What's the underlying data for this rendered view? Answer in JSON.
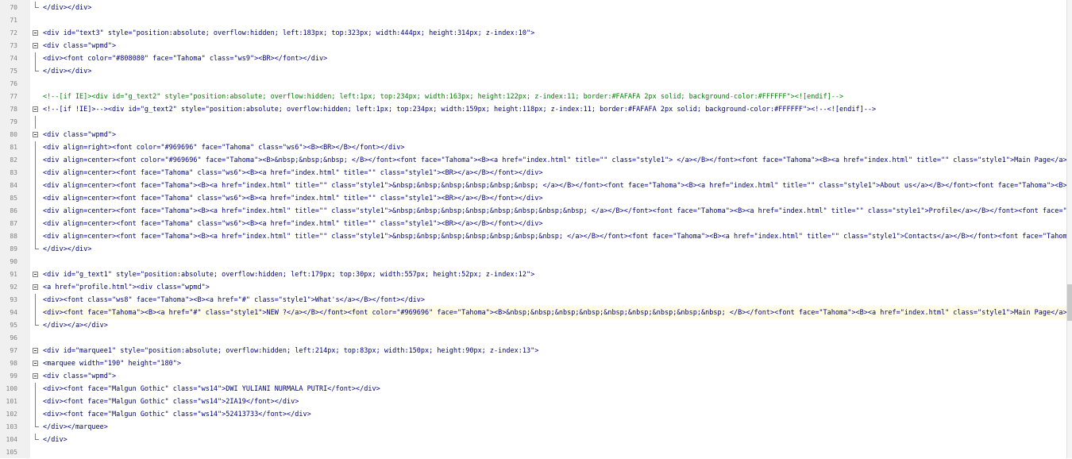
{
  "editor": {
    "lines": [
      {
        "num": "70",
        "text": "</div></div>",
        "fold": "end"
      },
      {
        "num": "71",
        "text": "",
        "fold": ""
      },
      {
        "num": "72",
        "text": "<div id=\"text3\" style=\"position:absolute; overflow:hidden; left:183px; top:323px; width:444px; height:314px; z-index:10\">",
        "fold": "box"
      },
      {
        "num": "73",
        "text": "<div class=\"wpmd\">",
        "fold": "box"
      },
      {
        "num": "74",
        "text": "<div><font color=\"#808080\" face=\"Tahoma\" class=\"ws9\"><BR></font></div>",
        "fold": "line"
      },
      {
        "num": "75",
        "text": "</div></div>",
        "fold": "end"
      },
      {
        "num": "76",
        "text": "",
        "fold": ""
      },
      {
        "num": "77",
        "text": "<!--[if IE]><div id=\"g_text2\" style=\"position:absolute; overflow:hidden; left:1px; top:234px; width:163px; height:122px; z-index:11; border:#FAFAFA 2px solid; background-color:#FFFFFF\"><![endif]-->",
        "fold": "",
        "style": "comment"
      },
      {
        "num": "78",
        "text": "<!--[if !IE]>--><div id=\"g_text2\" style=\"position:absolute; overflow:hidden; left:1px; top:234px; width:159px; height:118px; z-index:11; border:#FAFAFA 2px solid; background-color:#FFFFFF\"><!--<![endif]-->",
        "fold": "box"
      },
      {
        "num": "79",
        "text": "",
        "fold": "line"
      },
      {
        "num": "80",
        "text": "<div class=\"wpmd\">",
        "fold": "box"
      },
      {
        "num": "81",
        "text": "<div align=right><font color=\"#969696\" face=\"Tahoma\" class=\"ws6\"><B><BR></B></font></div>",
        "fold": "line"
      },
      {
        "num": "82",
        "text": "<div align=center><font color=\"#969696\" face=\"Tahoma\"><B>&nbsp;&nbsp;&nbsp; </B></font><font face=\"Tahoma\"><B><a href=\"index.html\" title=\"\" class=\"style1\"> </a></B></font><font face=\"Tahoma\"><B><a href=\"index.html\" title=\"\" class=\"style1\">Main Page</a>",
        "fold": "line"
      },
      {
        "num": "83",
        "text": "<div align=center><font face=\"Tahoma\" class=\"ws6\"><B><a href=\"index.html\" title=\"\" class=\"style1\"><BR></a></B></font></div>",
        "fold": "line"
      },
      {
        "num": "84",
        "text": "<div align=center><font face=\"Tahoma\"><B><a href=\"index.html\" title=\"\" class=\"style1\">&nbsp;&nbsp;&nbsp;&nbsp;&nbsp;&nbsp; </a></B></font><font face=\"Tahoma\"><B><a href=\"index.html\" title=\"\" class=\"style1\">About us</a></B></font><font face=\"Tahoma\"><B><a hre",
        "fold": "line"
      },
      {
        "num": "85",
        "text": "<div align=center><font face=\"Tahoma\" class=\"ws6\"><B><a href=\"index.html\" title=\"\" class=\"style1\"><BR></a></B></font></div>",
        "fold": "line"
      },
      {
        "num": "86",
        "text": "<div align=center><font face=\"Tahoma\"><B><a href=\"index.html\" title=\"\" class=\"style1\">&nbsp;&nbsp;&nbsp;&nbsp;&nbsp;&nbsp;&nbsp;&nbsp; </a></B></font><font face=\"Tahoma\"><B><a href=\"index.html\" title=\"\" class=\"style1\">Profile</a></B></font><font face=\"Tahoma",
        "fold": "line"
      },
      {
        "num": "87",
        "text": "<div align=center><font face=\"Tahoma\" class=\"ws6\"><B><a href=\"index.html\" title=\"\" class=\"style1\"><BR></a></B></font></div>",
        "fold": "line"
      },
      {
        "num": "88",
        "text": "<div align=center><font face=\"Tahoma\"><B><a href=\"index.html\" title=\"\" class=\"style1\">&nbsp;&nbsp;&nbsp;&nbsp;&nbsp;&nbsp;&nbsp; </a></B></font><font face=\"Tahoma\"><B><a href=\"index.html\" title=\"\" class=\"style1\">Contacts</a></B></font><font face=\"Tahoma\"><B>",
        "fold": "line"
      },
      {
        "num": "89",
        "text": "</div></div>",
        "fold": "end"
      },
      {
        "num": "90",
        "text": "",
        "fold": ""
      },
      {
        "num": "91",
        "text": "<div id=\"g_text1\" style=\"position:absolute; overflow:hidden; left:179px; top:30px; width:557px; height:52px; z-index:12\">",
        "fold": "box"
      },
      {
        "num": "92",
        "text": "<a href=\"profile.html\"><div class=\"wpmd\">",
        "fold": "box"
      },
      {
        "num": "93",
        "text": "<div><font class=\"ws8\" face=\"Tahoma\"><B><a href=\"#\" class=\"style1\">What's</a></B></font></div>",
        "fold": "line"
      },
      {
        "num": "94",
        "text": "<div><font face=\"Tahoma\"><B><a href=\"#\" class=\"style1\">NEW ?</a></B></font><font color=\"#969696\" face=\"Tahoma\"><B>&nbsp;&nbsp;&nbsp;&nbsp;&nbsp;&nbsp;&nbsp;&nbsp;&nbsp; </B></font><font face=\"Tahoma\"><B><a href=\"index.html\" class=\"style1\">Main Page</a></B></",
        "fold": "line",
        "style": "hl"
      },
      {
        "num": "95",
        "text": "</div></a></div>",
        "fold": "end"
      },
      {
        "num": "96",
        "text": "",
        "fold": ""
      },
      {
        "num": "97",
        "text": "<div id=\"marquee1\" style=\"position:absolute; overflow:hidden; left:214px; top:83px; width:150px; height:90px; z-index:13\">",
        "fold": "box"
      },
      {
        "num": "98",
        "text": "<marquee width=\"190\" height=\"180\">",
        "fold": "box"
      },
      {
        "num": "99",
        "text": "<div class=\"wpmd\">",
        "fold": "box"
      },
      {
        "num": "100",
        "text": "<div><font face=\"Malgun Gothic\" class=\"ws14\">DWI YULIANI NURMALA PUTRI</font></div>",
        "fold": "line"
      },
      {
        "num": "101",
        "text": "<div><font face=\"Malgun Gothic\" class=\"ws14\">2IA19</font></div>",
        "fold": "line"
      },
      {
        "num": "102",
        "text": "<div><font face=\"Malgun Gothic\" class=\"ws14\">52413733</font></div>",
        "fold": "line"
      },
      {
        "num": "103",
        "text": "</div></marquee>",
        "fold": "end"
      },
      {
        "num": "104",
        "text": "</div>",
        "fold": "end"
      },
      {
        "num": "105",
        "text": "",
        "fold": ""
      }
    ]
  }
}
